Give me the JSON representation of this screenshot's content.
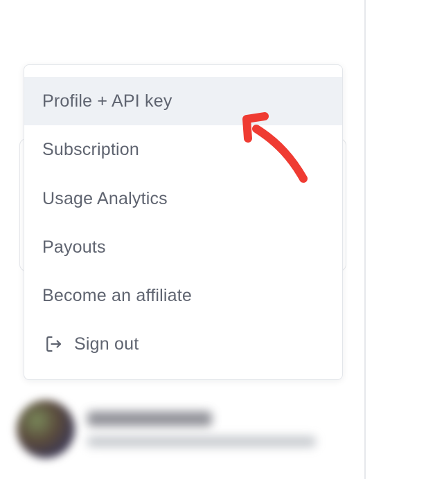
{
  "menu": {
    "items": [
      {
        "label": "Profile + API key",
        "active": true
      },
      {
        "label": "Subscription"
      },
      {
        "label": "Usage Analytics"
      },
      {
        "label": "Payouts"
      },
      {
        "label": "Become an affiliate"
      },
      {
        "label": "Sign out",
        "icon": "sign-out-icon"
      }
    ]
  },
  "annotation": {
    "color": "#ef3b32",
    "icon": "curved-arrow-icon"
  },
  "colors": {
    "menu_text": "#5f6470",
    "active_bg": "#eef1f5",
    "border": "#e3e6ea"
  }
}
